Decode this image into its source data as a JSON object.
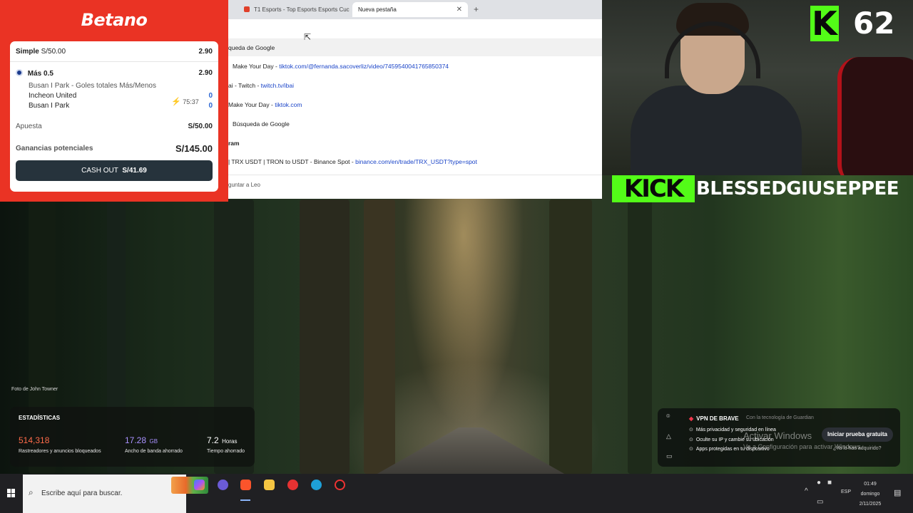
{
  "betano": {
    "logo": "Betano",
    "bet_type": "Simple",
    "bet_stake_header": "S/50.00",
    "bet_odds_header": "2.90",
    "selection": "Más 0.5",
    "selection_odds": "2.90",
    "market": "Busan I Park - Goles totales Más/Menos",
    "team_home": "Incheon United",
    "team_away": "Busan I Park",
    "match_time": "75:37",
    "score_home": "0",
    "score_away": "0",
    "stake_label": "Apuesta",
    "stake_value": "S/50.00",
    "winnings_label": "Ganancias potenciales",
    "winnings_value": "S/145.00",
    "cashout_label": "CASH OUT",
    "cashout_value": "S/41.69"
  },
  "browser": {
    "tabs": [
      {
        "label": "T1 Esports - Top Esports Esports Cuc",
        "active": false
      },
      {
        "label": "Nueva pestaña",
        "active": true
      }
    ],
    "suggestions": [
      {
        "prefix": "",
        "text": "queda de Google",
        "url": ""
      },
      {
        "prefix": "",
        "text": "Make Your Day - ",
        "url": "tiktok.com/@fernanda.sacoverliz/video/7459540041765850374"
      },
      {
        "prefix": "",
        "text": "ai - Twitch - ",
        "url": "twitch.tv/ibai"
      },
      {
        "prefix": "",
        "text": "Make Your Day - ",
        "url": "tiktok.com"
      },
      {
        "prefix": "",
        "text": "Búsqueda de Google",
        "url": ""
      },
      {
        "prefix": "ram",
        "text": "",
        "url": ""
      },
      {
        "prefix": "",
        "text": "| TRX USDT | TRON to USDT - Binance Spot - ",
        "url": "binance.com/en/trade/TRX_USDT?type=spot"
      }
    ],
    "bottom_text": "guntar a Leo"
  },
  "webcam": {
    "kick_badge": "K",
    "viewer_count": "62"
  },
  "kick_banner": {
    "logo": "KICK",
    "channel": "BLESSEDGIUSEPPEE"
  },
  "wallpaper": {
    "credit": "Foto de John Towner"
  },
  "stats": {
    "title": "ESTADÍSTICAS",
    "trackers_value": "514,318",
    "trackers_label": "Rastreadores y anuncios bloqueados",
    "trackers_color": "#ff6b4a",
    "bandwidth_value": "17.28",
    "bandwidth_unit": "GB",
    "bandwidth_label": "Ancho de banda ahorrado",
    "bandwidth_color": "#a991ff",
    "time_value": "7.2",
    "time_unit": "Horas",
    "time_label": "Tiempo ahorrado"
  },
  "vpn": {
    "title": "VPN DE BRAVE",
    "powered": "Con la tecnología de Guardian",
    "items": [
      "Más privacidad y seguridad en línea",
      "Oculte su IP y cambie su ubicación",
      "Apps protegidas en tu dispositivo"
    ],
    "trial_button": "Iniciar prueba gratuita",
    "subscribed_link": "¿Ya lo has adquirido?"
  },
  "windows_activation": {
    "line1": "Activar Windows",
    "line2": "Ve a Configuración para activar Windows."
  },
  "taskbar": {
    "search_placeholder": "Escribe aquí para buscar.",
    "language": "ESP",
    "time": "01:49",
    "day": "domingo",
    "date": "2/11/2025"
  }
}
